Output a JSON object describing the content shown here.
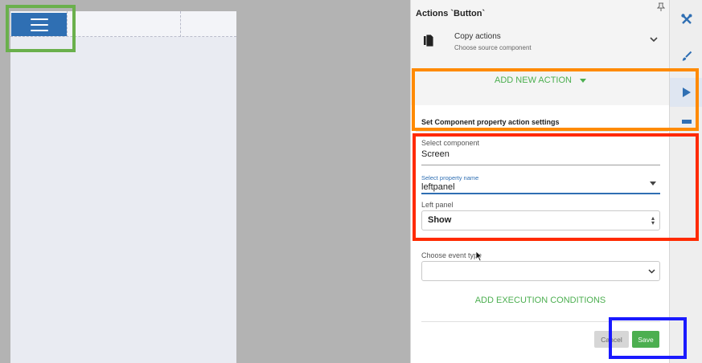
{
  "canvas": {
    "menu_button_icon": "hamburger-icon"
  },
  "panel": {
    "title": "Actions `Button`",
    "pin_icon": "pin-icon",
    "copy_actions": {
      "title": "Copy actions",
      "subtitle": "Choose source component"
    },
    "add_new_action_label": "ADD NEW ACTION",
    "settings_title": "Set Component property action settings",
    "select_component": {
      "label": "Select component",
      "value": "Screen"
    },
    "select_property": {
      "label": "Select property name",
      "value": "leftpanel"
    },
    "left_panel": {
      "label": "Left panel",
      "value": "Show"
    },
    "event_type": {
      "label": "Choose event type",
      "value": ""
    },
    "add_execution_conditions_label": "ADD EXECUTION CONDITIONS",
    "cancel_label": "Cancel",
    "save_label": "Save"
  },
  "toolbar": {
    "items": [
      "wrench-cross-icon",
      "brush-icon",
      "play-icon",
      "layers-icon"
    ],
    "active": "play-icon"
  },
  "colors": {
    "accent_green": "#4caf50",
    "primary_blue": "#2f6fb3",
    "highlight_green": "#6ab04c",
    "highlight_orange": "#ff8a00",
    "highlight_red": "#ff2a00",
    "highlight_blue": "#1a1aff"
  }
}
